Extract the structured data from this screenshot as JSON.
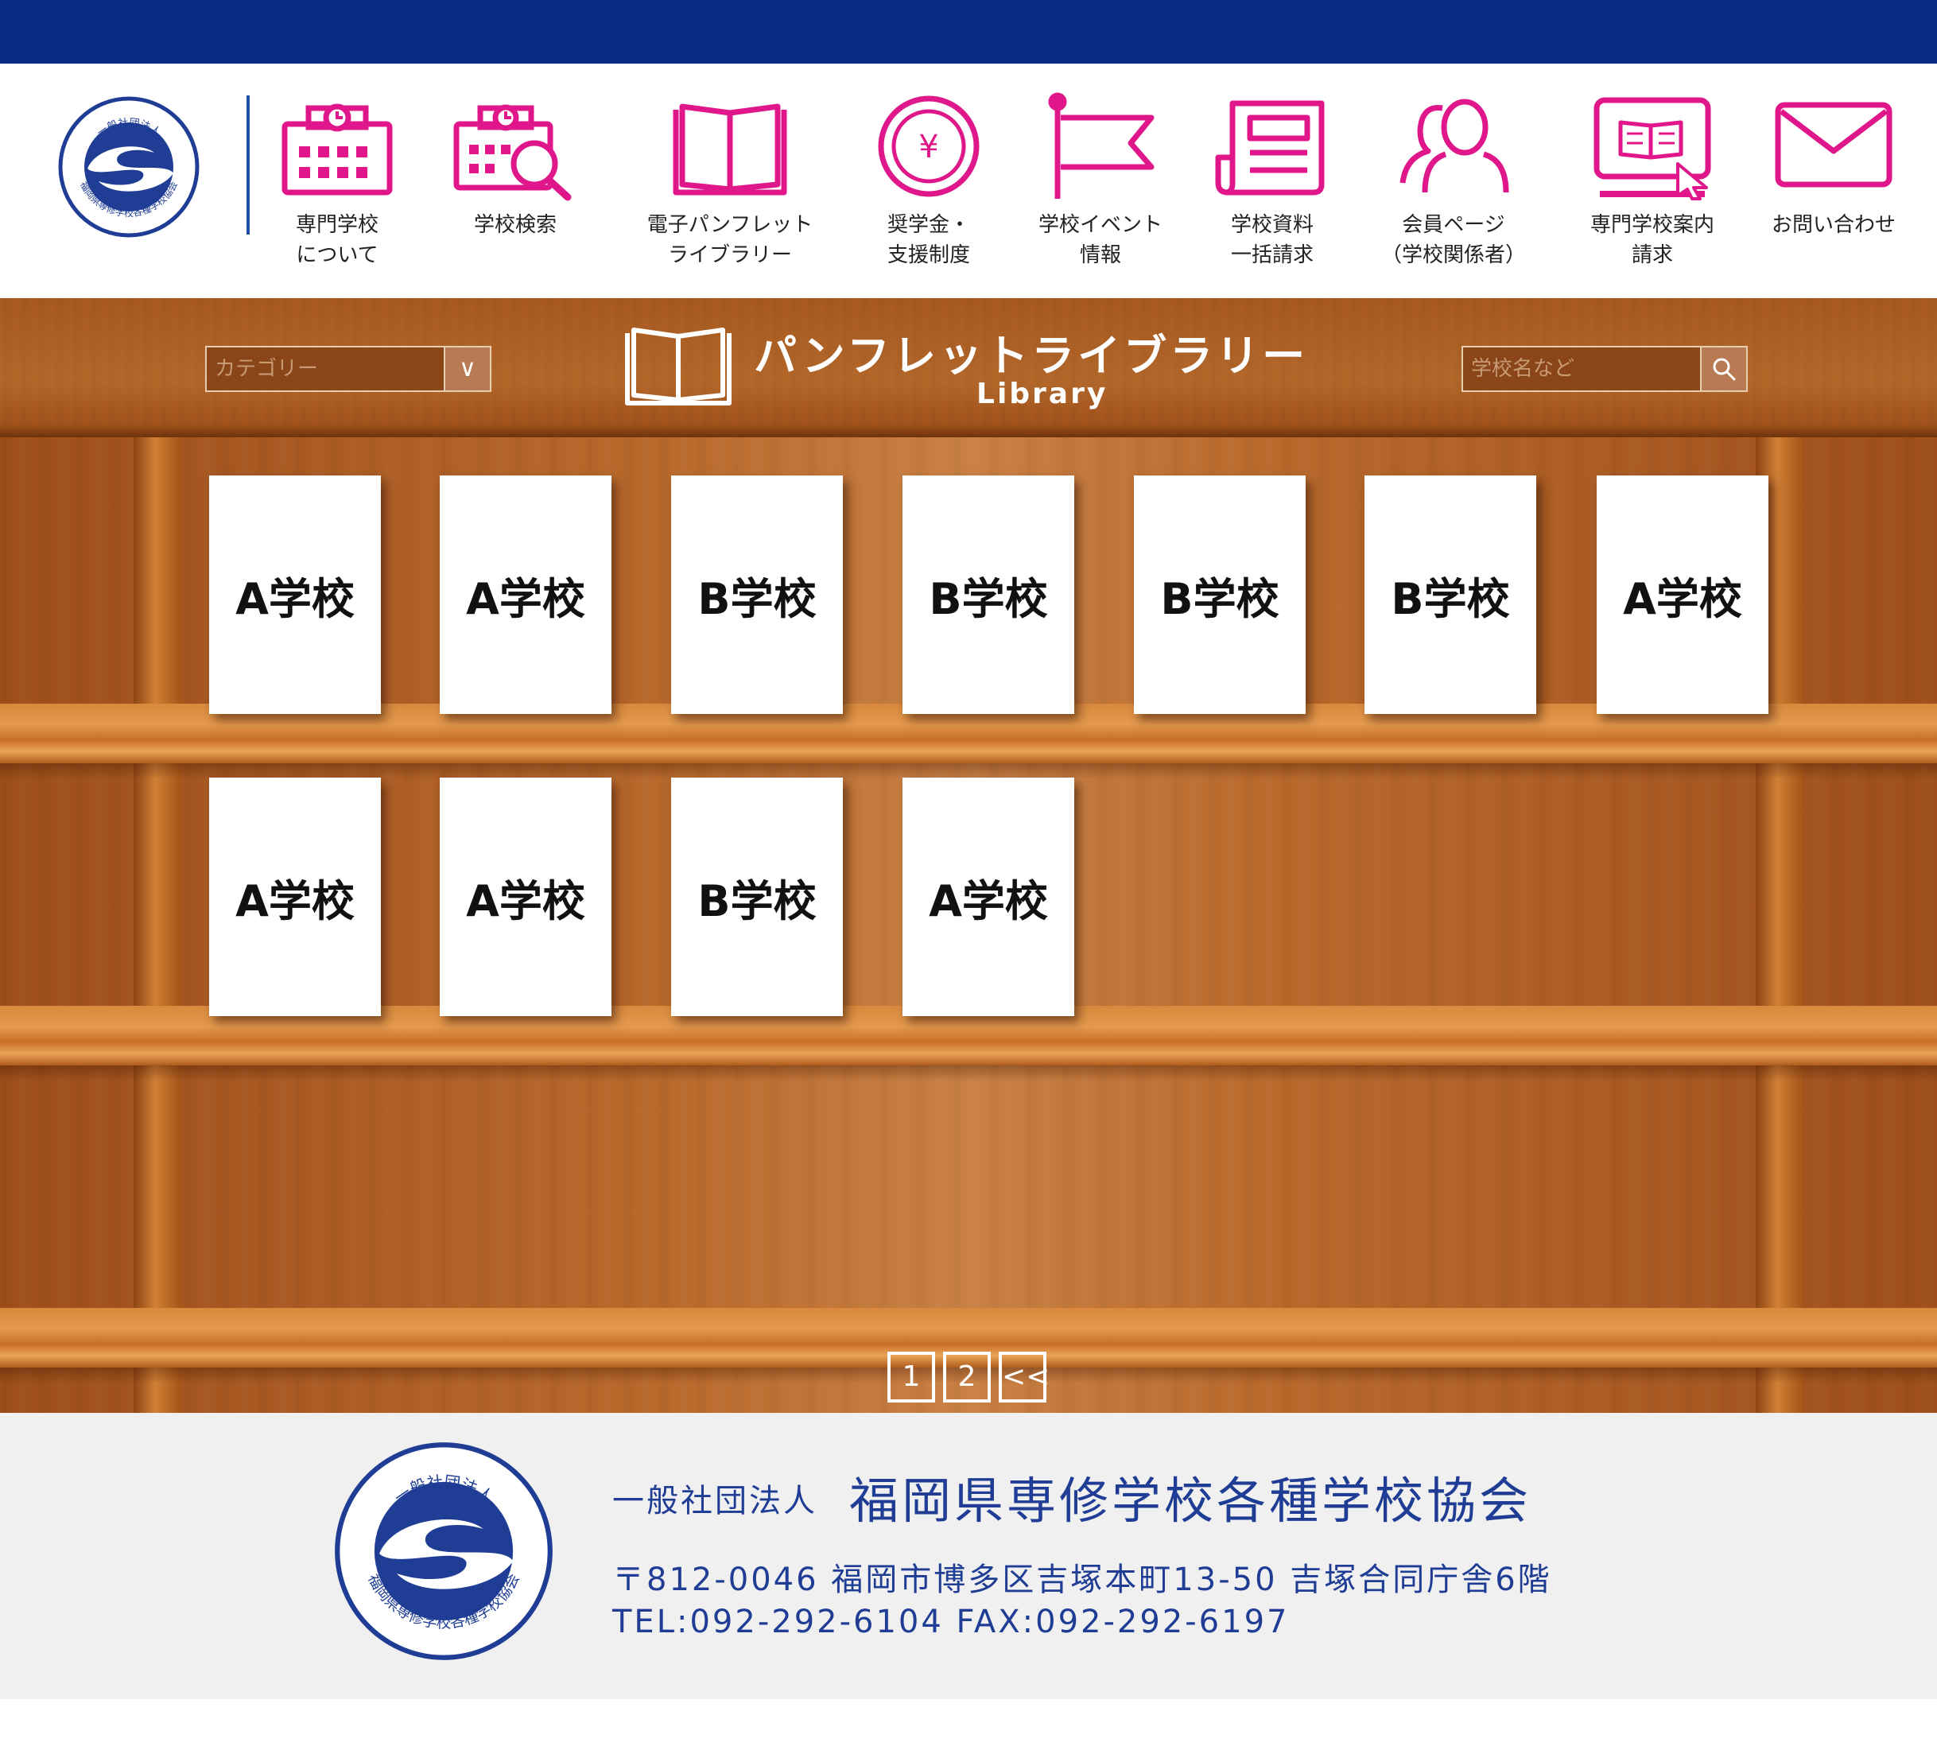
{
  "colors": {
    "topbar": "#0b2a84",
    "icon_accent": "#e0178a",
    "footer_text": "#1f3d95"
  },
  "logo": {
    "top_text": "一般社団法人",
    "bottom_text": "福岡県専修学校各種学校協会",
    "symbol": "s-swoosh-logo"
  },
  "nav": [
    {
      "id": "about",
      "icon": "school-calendar-icon",
      "label_line1": "専門学校",
      "label_line2": "について"
    },
    {
      "id": "search",
      "icon": "school-search-icon",
      "label_line1": "学校検索",
      "label_line2": ""
    },
    {
      "id": "pamphlet",
      "icon": "open-book-icon",
      "label_line1": "電子パンフレット",
      "label_line2": "ライブラリー"
    },
    {
      "id": "scholarship",
      "icon": "yen-coin-icon",
      "label_line1": "奨学金・",
      "label_line2": "支援制度"
    },
    {
      "id": "events",
      "icon": "flag-icon",
      "label_line1": "学校イベント",
      "label_line2": "情報"
    },
    {
      "id": "materials",
      "icon": "document-icon",
      "label_line1": "学校資料",
      "label_line2": "一括請求"
    },
    {
      "id": "members",
      "icon": "members-icon",
      "label_line1": "会員ページ",
      "label_line2": "（学校関係者）"
    },
    {
      "id": "guide",
      "icon": "monitor-book-icon",
      "label_line1": "専門学校案内",
      "label_line2": "請求"
    },
    {
      "id": "contact",
      "icon": "mail-icon",
      "label_line1": "お問い合わせ",
      "label_line2": ""
    }
  ],
  "library": {
    "title": "パンフレットライブラリー",
    "subtitle": "Library",
    "category_placeholder": "カテゴリー",
    "category_button": "∨",
    "search_placeholder": "学校名など",
    "shelves": [
      [
        "A学校",
        "A学校",
        "B学校",
        "B学校",
        "B学校",
        "B学校",
        "A学校"
      ],
      [
        "A学校",
        "A学校",
        "B学校",
        "A学校"
      ]
    ],
    "pagination": [
      "1",
      "2",
      "<<"
    ]
  },
  "footer": {
    "org_type": "一般社団法人",
    "org_name": "福岡県専修学校各種学校協会",
    "address": "〒812-0046 福岡市博多区吉塚本町13-50 吉塚合同庁舎6階",
    "tel_fax": "TEL:092-292-6104 FAX:092-292-6197"
  }
}
